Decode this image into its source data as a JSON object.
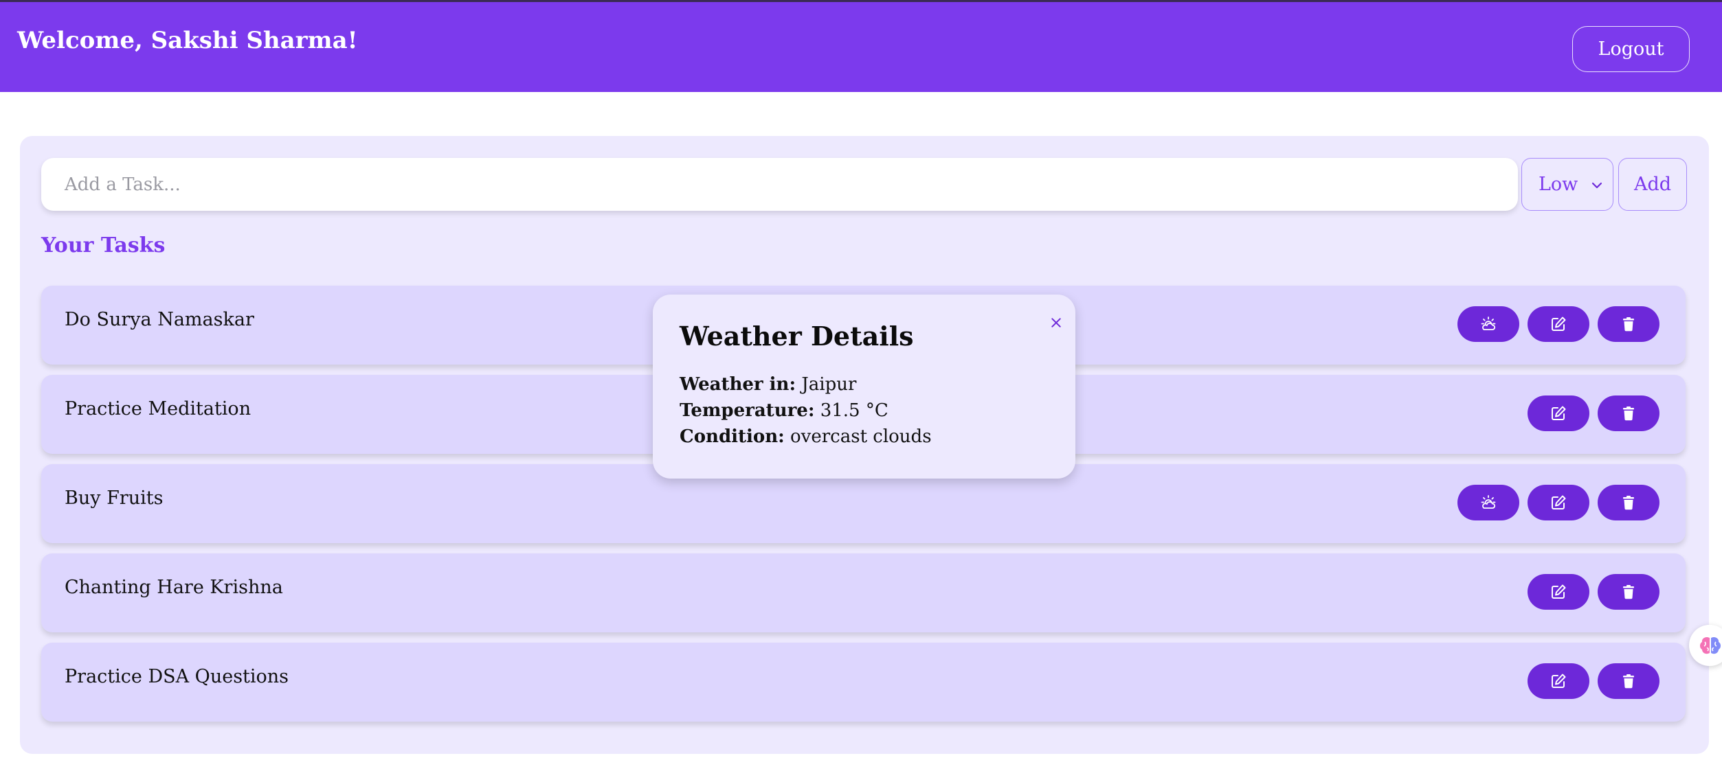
{
  "header": {
    "welcome": "Welcome, Sakshi Sharma!",
    "logout_label": "Logout"
  },
  "task_form": {
    "placeholder": "Add a Task...",
    "priority_selected": "Low",
    "add_label": "Add"
  },
  "section_title": "Your Tasks",
  "tasks": [
    {
      "title": "Do Surya Namaskar",
      "has_weather": true
    },
    {
      "title": "Practice Meditation",
      "has_weather": false
    },
    {
      "title": "Buy Fruits",
      "has_weather": true
    },
    {
      "title": "Chanting Hare Krishna",
      "has_weather": false
    },
    {
      "title": "Practice DSA Questions",
      "has_weather": false
    }
  ],
  "weather_popup": {
    "title": "Weather Details",
    "close_symbol": "×",
    "location_label": "Weather in:",
    "location": "Jaipur",
    "temperature_label": "Temperature:",
    "temperature": "31.5 °C",
    "condition_label": "Condition:",
    "condition": "overcast clouds"
  },
  "icons": {
    "weather": "cloud-sun-icon",
    "edit": "edit-icon",
    "delete": "trash-icon",
    "chevron": "chevron-down-icon",
    "close": "close-icon",
    "widget": "brain-icon"
  },
  "colors": {
    "primary": "#7c3aed",
    "button": "#6d28d9",
    "panel": "#ede9fe",
    "task_row": "#ddd6fe"
  }
}
